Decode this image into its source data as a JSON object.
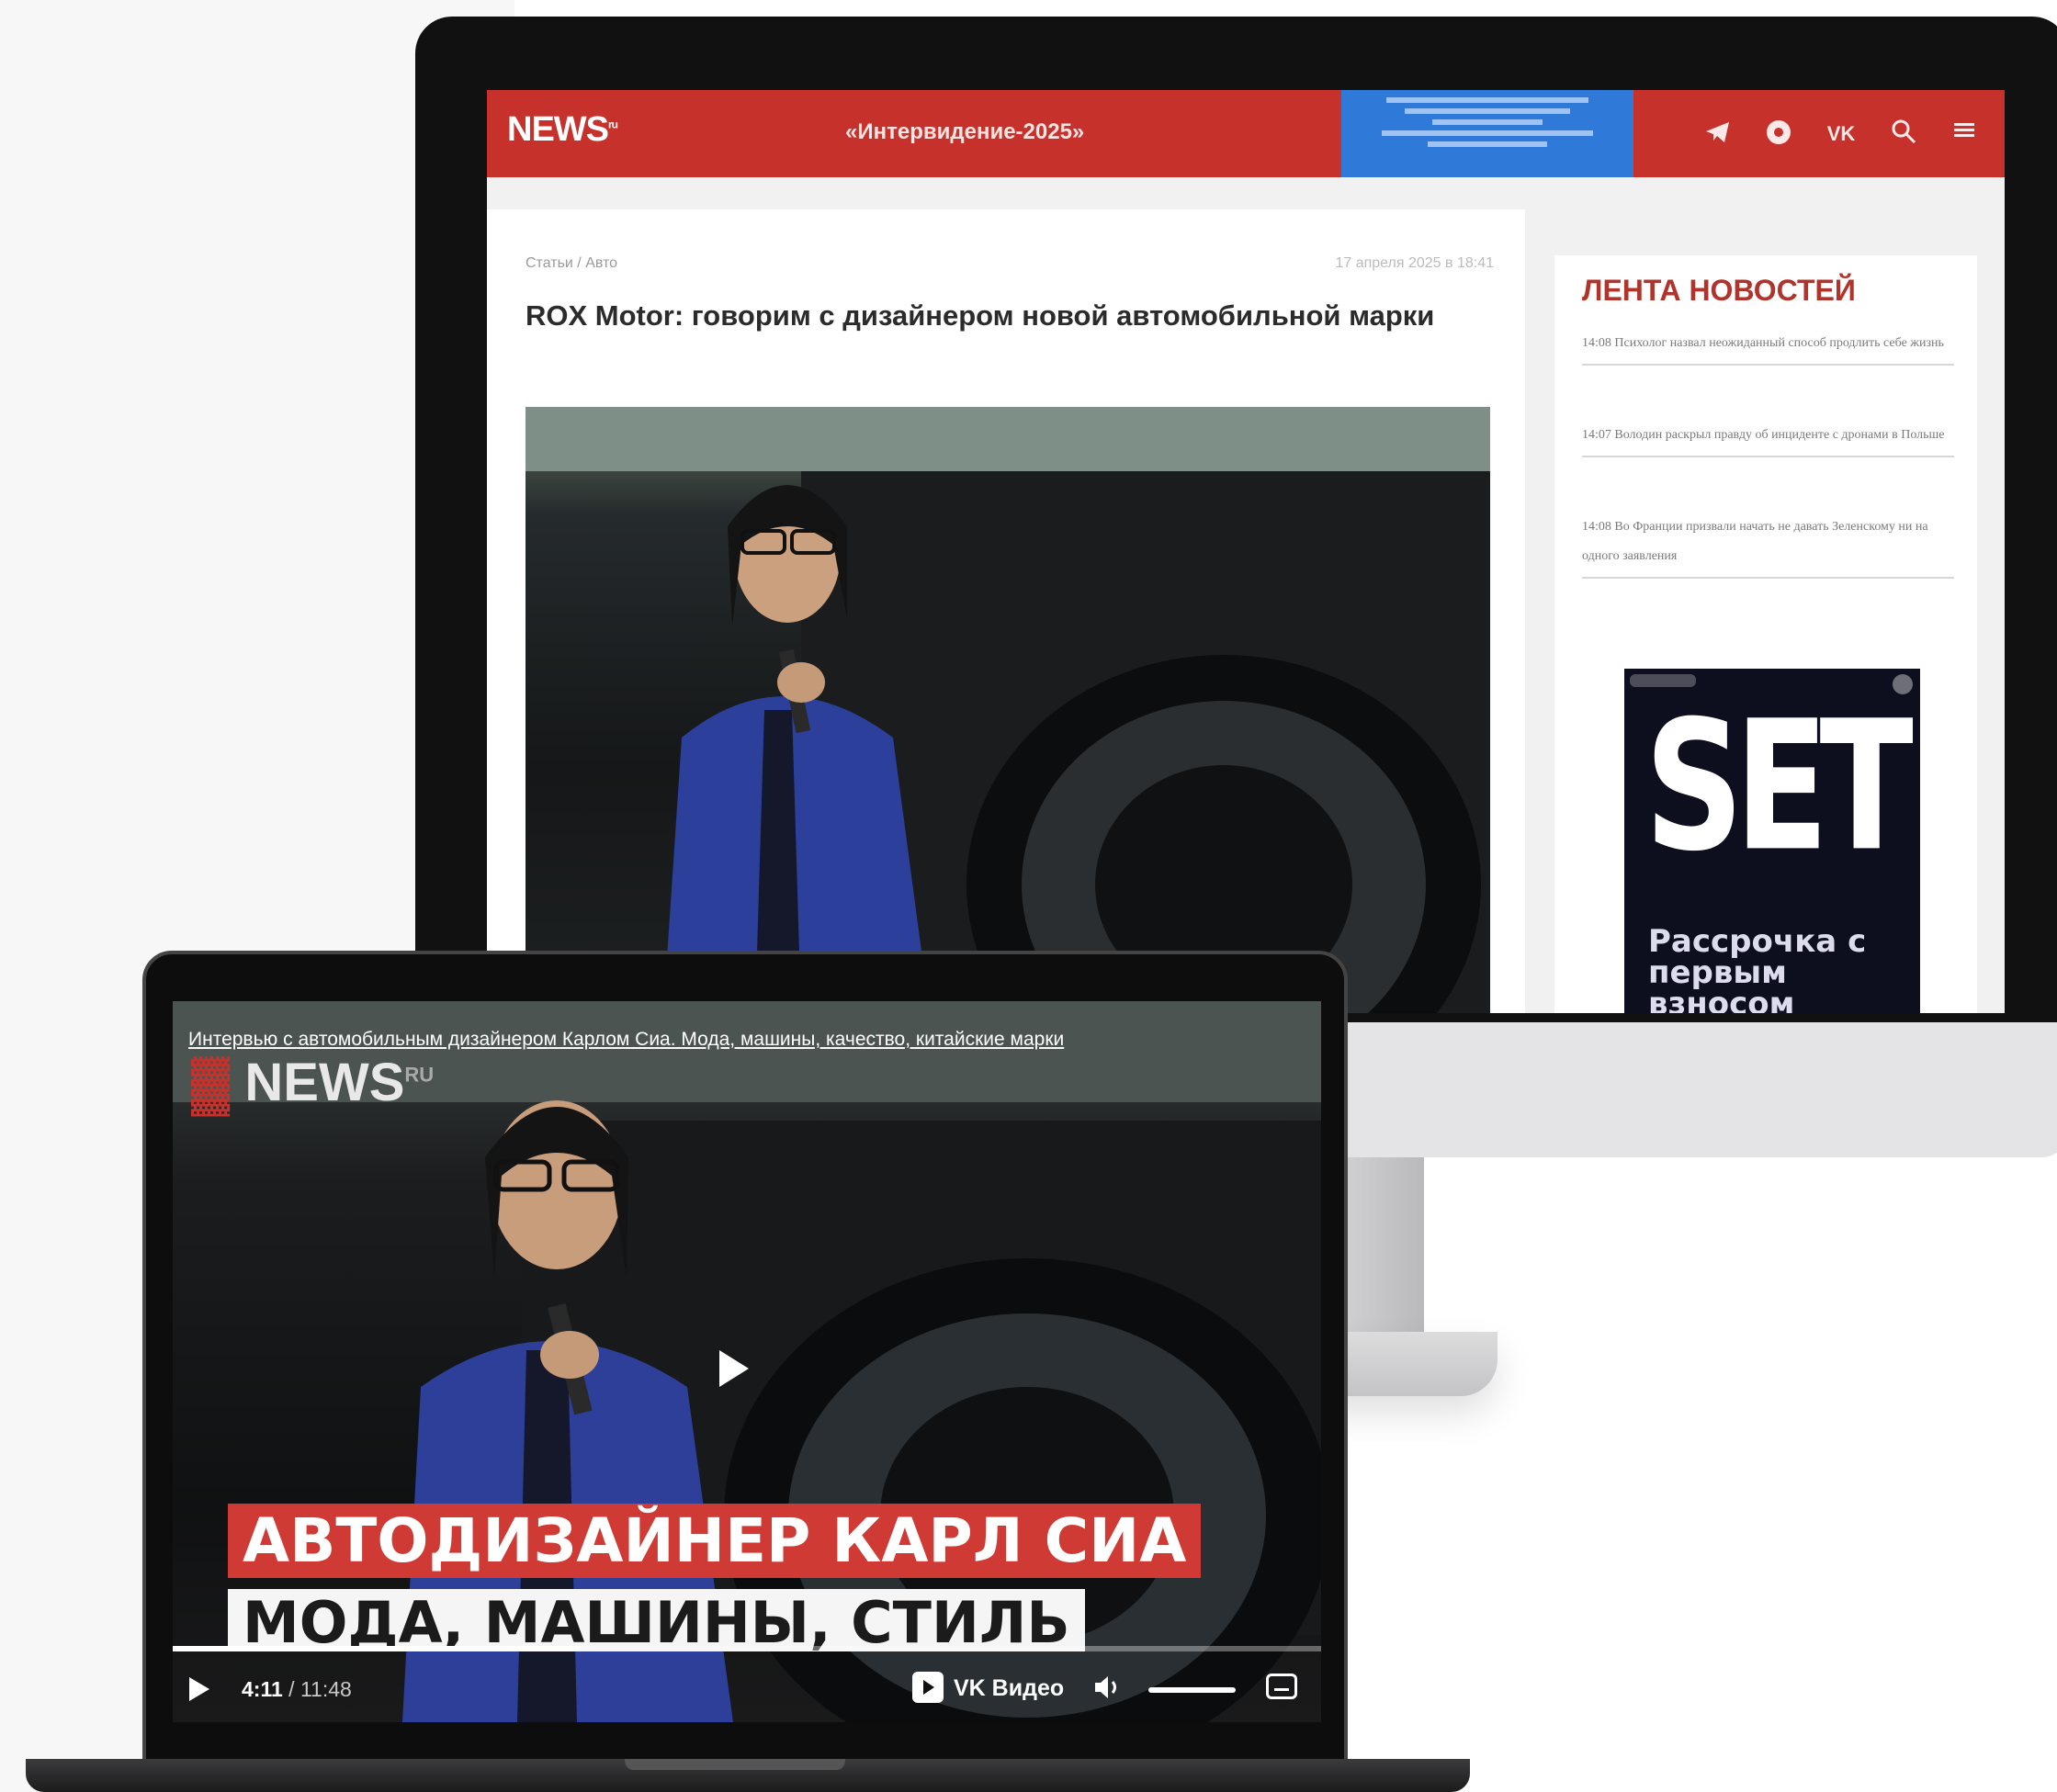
{
  "desktop_site": {
    "logo": "NEWS",
    "logo_suffix": "ru",
    "header_promo": "«Интервидение-2025»",
    "ad_banner_text": "",
    "breadcrumb": "Статьи / Авто",
    "date": "17 апреля 2025 в 18:41",
    "article_title": "ROX Motor: говорим с дизайнером новой автомобильной марки",
    "sidebar_title": "ЛЕНТА НОВОСТЕЙ",
    "news_items": [
      "14:08 Психолог назвал неожиданный способ продлить себе жизнь",
      "14:07 Володин раскрыл правду об инциденте с дронами в Польше",
      "14:08 Во Франции призвали начать не давать Зеленскому ни на одного заявления"
    ],
    "ad_card": {
      "title": "SET",
      "text": "Рассрочка с первым взносом"
    },
    "header_icons": [
      "telegram-icon",
      "dzen-icon",
      "vk-icon",
      "search-icon",
      "menu-icon"
    ]
  },
  "laptop_video": {
    "title": "Интервью с автомобильным дизайнером Карлом Сиа. Мода, машины, качество, китайские марки",
    "logo": "NEWS",
    "logo_suffix": "RU",
    "caption_line1": "АВТОДИЗАЙНЕР КАРЛ СИА",
    "caption_line2": "МОДА, МАШИНЫ, СТИЛЬ",
    "time_current": "4:11",
    "time_total": "11:48",
    "player_brand": "VK Видео",
    "progress_fraction": 0.355
  },
  "colors": {
    "brand_red": "#c6312c",
    "ad_blue": "#2f79d8",
    "sidebar_title_red": "#b1342c"
  }
}
